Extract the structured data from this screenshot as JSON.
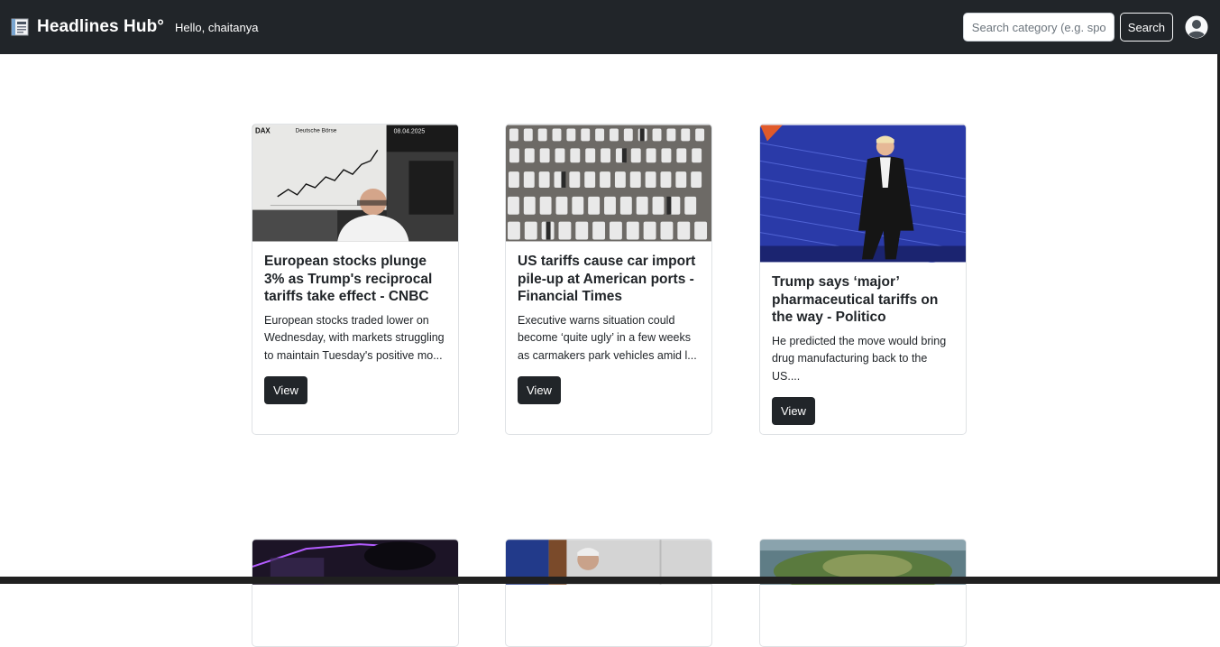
{
  "navbar": {
    "brand": "Headlines Hub°",
    "greeting": "Hello, chaitanya",
    "search_placeholder": "Search category (e.g. sports)",
    "search_button": "Search"
  },
  "articles": [
    {
      "title": "European stocks plunge 3% as Trump's reciprocal tariffs take effect - CNBC",
      "description": "European stocks traded lower on Wednesday, with markets struggling to maintain Tuesday's positive mo...",
      "button": "View",
      "image_caption_top": "DAX",
      "image_caption_exchange": "Deutsche Börse",
      "image_caption_date": "08.04.2025"
    },
    {
      "title": "US tariffs cause car import pile-up at American ports - Financial Times",
      "description": "Executive warns situation could become ‘quite ugly’ in a few weeks as carmakers park vehicles amid l...",
      "button": "View"
    },
    {
      "title": "Trump says ‘major’ pharmaceutical tariffs on the way - Politico",
      "description": "He predicted the move would bring drug manufacturing back to the US....",
      "button": "View"
    },
    {},
    {},
    {}
  ],
  "colors": {
    "navbar_bg": "#212529",
    "button_bg": "#212529",
    "accent": "#ffffff"
  },
  "icons": {
    "brand": "newspaper-icon",
    "profile": "user-avatar-icon"
  }
}
